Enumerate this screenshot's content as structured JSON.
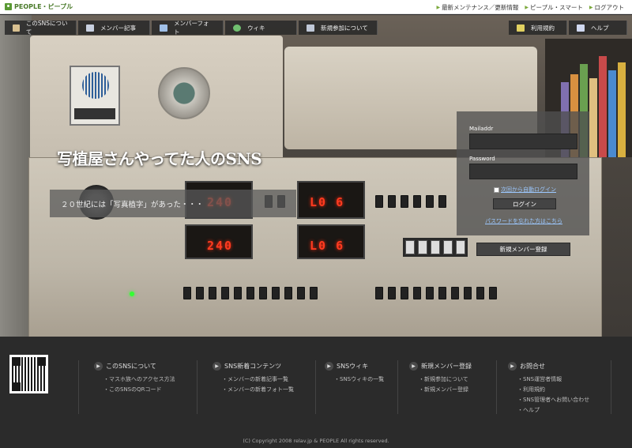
{
  "header": {
    "logo_text": "PEOPLE・ピープル",
    "links": [
      "最新メンテナンス／更新情報",
      "ピープル・スマート",
      "ログアウト"
    ]
  },
  "nav": {
    "left": [
      {
        "label": "このSNSについて",
        "icon": "people-icon",
        "color": "#d8c090"
      },
      {
        "label": "メンバー記事",
        "icon": "note-icon",
        "color": "#c8d0e0"
      },
      {
        "label": "メンバーフォト",
        "icon": "photo-icon",
        "color": "#a0c0e8"
      },
      {
        "label": "ウィキ",
        "icon": "globe-icon",
        "color": "#70c070"
      },
      {
        "label": "新規参加について",
        "icon": "users-icon",
        "color": "#c0c8d8"
      }
    ],
    "right": [
      {
        "label": "利用規約",
        "icon": "pen-icon",
        "color": "#e0d060"
      },
      {
        "label": "ヘルプ",
        "icon": "help-icon",
        "color": "#d0d8f0"
      }
    ]
  },
  "hero": {
    "headline": "写植屋さんやってた人のSNS",
    "subline": "２０世紀には「写真植字」があった・・・",
    "displays": [
      "240",
      "L0 6",
      "240",
      "L0 6"
    ]
  },
  "login": {
    "mail_label": "Mailaddr",
    "mail_value": "",
    "password_label": "Password",
    "password_value": "",
    "auto_login": "次回から自動ログイン",
    "login_button": "ログイン",
    "forgot": "パスワードを忘れた方はこちら",
    "register_button": "新規メンバー登録"
  },
  "footer": {
    "columns": [
      {
        "title": "このSNSについて",
        "links": [
          "マスホ族へのアクセス方法",
          "このSNSのQRコード"
        ]
      },
      {
        "title": "SNS新着コンテンツ",
        "links": [
          "メンバーの新着記事一覧",
          "メンバーの新着フォト一覧"
        ]
      },
      {
        "title": "SNSウィキ",
        "links": [
          "SNSウィキの一覧"
        ]
      },
      {
        "title": "新規メンバー登録",
        "links": [
          "新規参加について",
          "新規メンバー登録"
        ]
      },
      {
        "title": "お問合せ",
        "links": [
          "SNS運営者情報",
          "利用規約",
          "SNS管理者へお問い合わせ",
          "ヘルプ"
        ]
      }
    ],
    "copyright": "(C) Copyright 2008 relav.jp & PEOPLE All rights reserved."
  }
}
